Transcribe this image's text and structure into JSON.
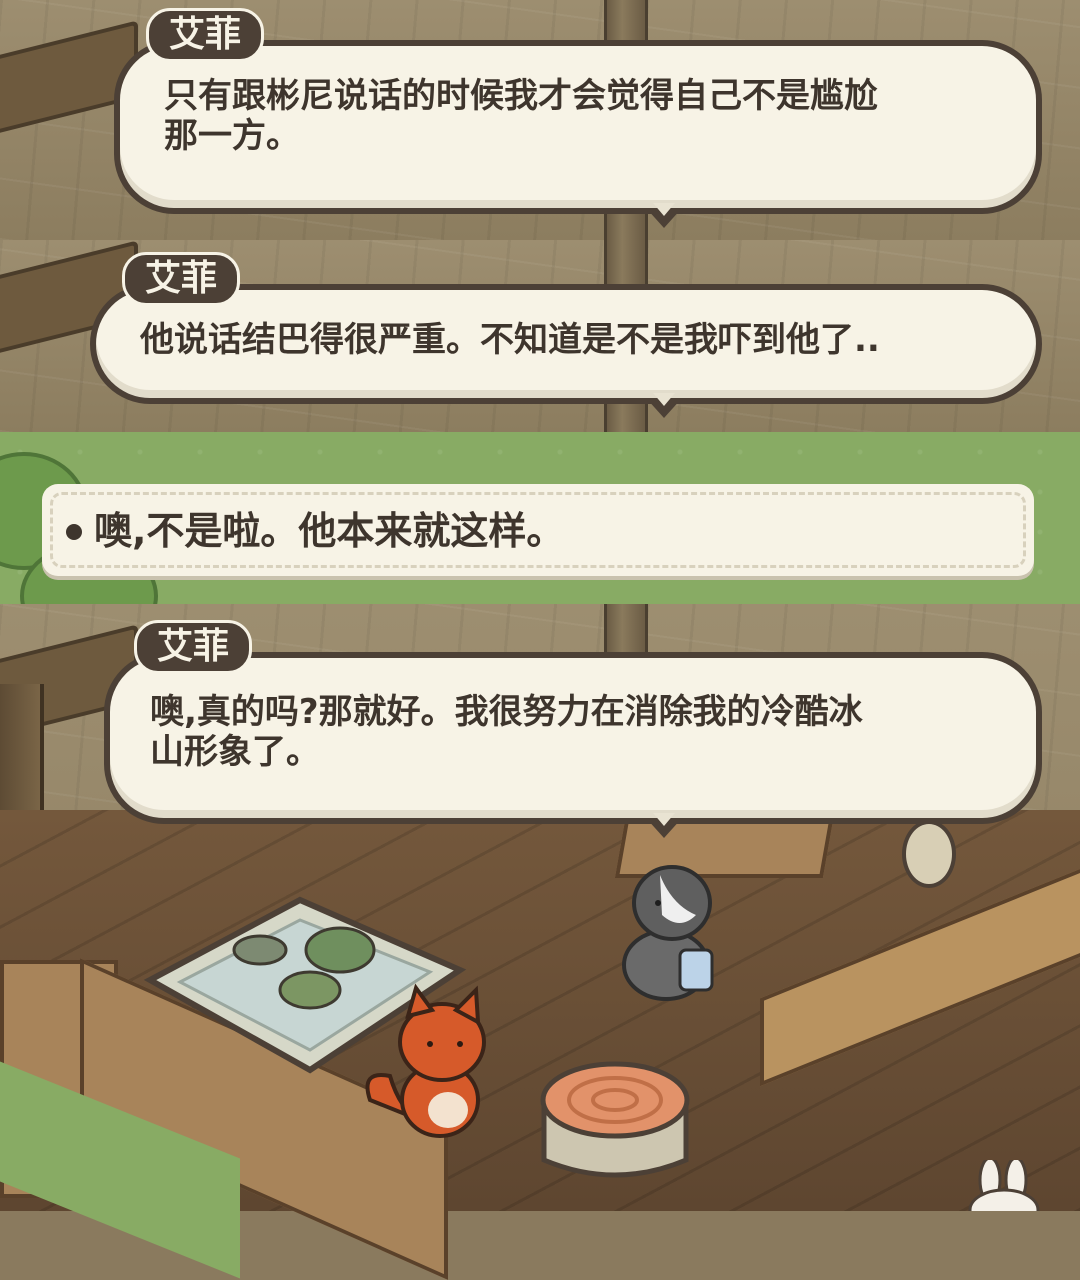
{
  "colors": {
    "bubble_fill": "#f7f3e6",
    "bubble_outline": "#4c4036",
    "text": "#3e352d",
    "grass": "#88ab64"
  },
  "dialogues": [
    {
      "speaker": "艾菲",
      "lines": [
        "只有跟彬尼说话的时候我才会觉得自己不是尴尬",
        "那一方。"
      ]
    },
    {
      "speaker": "艾菲",
      "lines": [
        "他说话结巴得很严重。不知道是不是我吓到他了.."
      ]
    },
    {
      "speaker": "艾菲",
      "lines": [
        "噢,真的吗?那就好。我很努力在消除我的冷酷冰",
        "山形象了。"
      ]
    }
  ],
  "choice": {
    "text": "噢,不是啦。他本来就这样。"
  },
  "scene": {
    "characters": [
      "fox-icon",
      "badger-icon",
      "rabbit-icon"
    ],
    "objects": [
      "zen-garden-icon",
      "tree-stump-table-icon"
    ]
  }
}
